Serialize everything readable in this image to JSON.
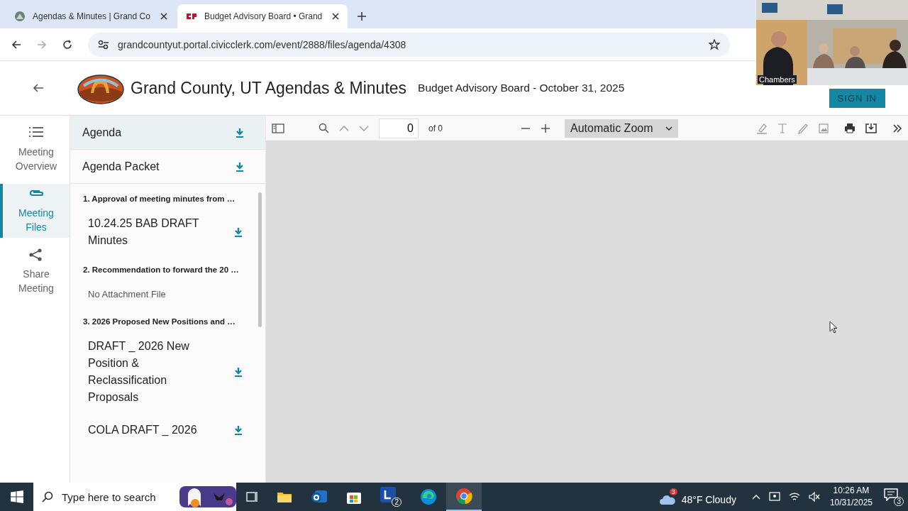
{
  "browser": {
    "tabs": [
      {
        "title": "Agendas & Minutes | Grand Co",
        "selected": false
      },
      {
        "title": "Budget Advisory Board • Grand",
        "selected": true
      }
    ],
    "url": "grandcountyut.portal.civicclerk.com/event/2888/files/agenda/4308"
  },
  "header": {
    "site_title": "Grand County, UT Agendas & Minutes",
    "meeting_title": "Budget Advisory Board - October 31, 2025",
    "sign_in": "SIGN IN"
  },
  "nav": [
    {
      "label": "Meeting Overview",
      "selected": false
    },
    {
      "label": "Meeting Files",
      "selected": true
    },
    {
      "label": "Share Meeting",
      "selected": false
    }
  ],
  "files": {
    "top": [
      {
        "label": "Agenda",
        "selected": true
      },
      {
        "label": "Agenda Packet",
        "selected": false
      }
    ],
    "sections": [
      {
        "heading": "1. Approval of meeting minutes from …",
        "items": [
          {
            "kind": "file",
            "name": "10.24.25 BAB DRAFT Minutes"
          }
        ]
      },
      {
        "heading": "2. Recommendation to forward the 20 …",
        "items": [
          {
            "kind": "empty",
            "name": "No Attachment File"
          }
        ]
      },
      {
        "heading": "3. 2026 Proposed New Positions and …",
        "items": [
          {
            "kind": "file",
            "name": "DRAFT _ 2026 New Position & Reclassification Proposals"
          },
          {
            "kind": "file",
            "name": "COLA DRAFT _ 2026"
          }
        ]
      }
    ]
  },
  "viewer": {
    "page": "0",
    "page_count": "of 0",
    "zoom": "Automatic Zoom"
  },
  "video": {
    "label": "Chambers"
  },
  "taskbar": {
    "search_placeholder": "Type here to search",
    "l_badge": "2",
    "weather_badge": "3",
    "weather": "48°F Cloudy",
    "time": "10:26 AM",
    "date": "10/31/2025",
    "notifications": "3"
  }
}
